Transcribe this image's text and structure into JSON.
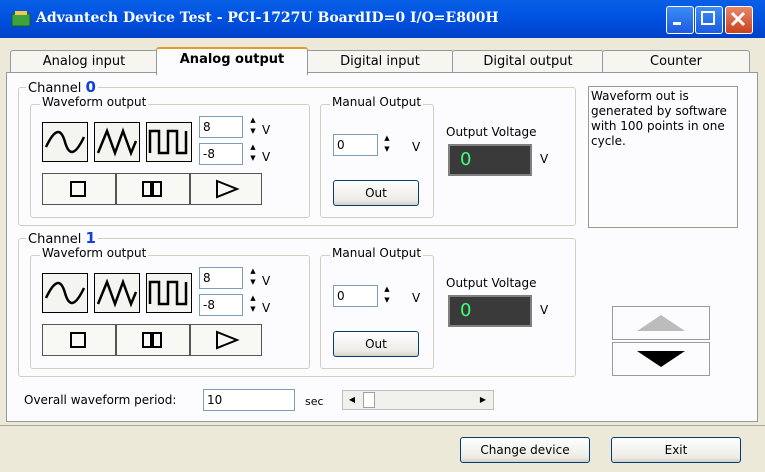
{
  "window": {
    "title": "Advantech Device Test - PCI-1727U BoardID=0 I/O=E800H"
  },
  "tabs": [
    {
      "label": "Analog input",
      "active": false
    },
    {
      "label": "Analog output",
      "active": true
    },
    {
      "label": "Digital input",
      "active": false
    },
    {
      "label": "Digital output",
      "active": false
    },
    {
      "label": "Counter",
      "active": false
    }
  ],
  "channels": [
    {
      "label": "Channel",
      "number": "0",
      "waveform_title": "Waveform output",
      "high": "8",
      "low": "-8",
      "unit": "V",
      "manual_title": "Manual Output",
      "manual_value": "0",
      "out_label": "Out",
      "output_voltage_label": "Output Voltage",
      "output_voltage": "0"
    },
    {
      "label": "Channel",
      "number": "1",
      "waveform_title": "Waveform output",
      "high": "8",
      "low": "-8",
      "unit": "V",
      "manual_title": "Manual Output",
      "manual_value": "0",
      "out_label": "Out",
      "output_voltage_label": "Output Voltage",
      "output_voltage": "0"
    }
  ],
  "info_text": "Waveform out is generated by software with 100 points in one cycle.",
  "period": {
    "label": "Overall waveform period:",
    "value": "10",
    "unit": "sec"
  },
  "buttons": {
    "change_device": "Change device",
    "exit": "Exit"
  },
  "colors": {
    "titlebar": "#0054E3",
    "channel_number": "#1040E0",
    "voltage_display_bg": "#3A3A3A",
    "voltage_display_text": "#3CFF7A"
  }
}
